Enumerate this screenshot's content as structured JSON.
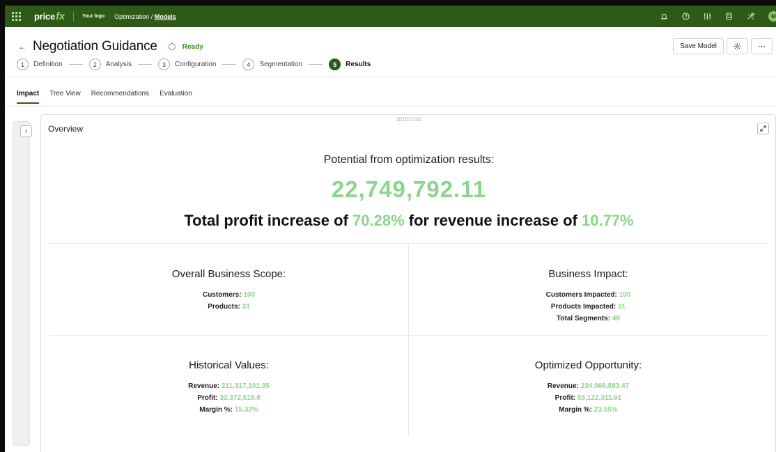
{
  "topbar": {
    "brand_main": "price",
    "brand_fx": "fx",
    "logo_text": "Your logo",
    "crumb_section": "Optimization /",
    "crumb_link": "Models",
    "avatar_initial": "M"
  },
  "header": {
    "title": "Negotiation Guidance",
    "status": "Ready",
    "save_label": "Save Model",
    "steps": [
      {
        "num": "1",
        "label": "Definition"
      },
      {
        "num": "2",
        "label": "Analysis"
      },
      {
        "num": "3",
        "label": "Configuration"
      },
      {
        "num": "4",
        "label": "Segmentation"
      },
      {
        "num": "5",
        "label": "Results"
      }
    ]
  },
  "tabs": [
    {
      "label": "Impact"
    },
    {
      "label": "Tree View"
    },
    {
      "label": "Recommendations"
    },
    {
      "label": "Evaluation"
    }
  ],
  "panel": {
    "title": "Overview",
    "potential_title": "Potential from optimization results:",
    "potential_value": "22,749,792.11",
    "profit_prefix": "Total profit increase of",
    "profit_pct": "70.28%",
    "revenue_prefix": "for revenue increase of",
    "revenue_pct": "10.77%"
  },
  "scope": {
    "title": "Overall Business Scope:",
    "customers_label": "Customers:",
    "customers": "100",
    "products_label": "Products:",
    "products": "31"
  },
  "impact": {
    "title": "Business Impact:",
    "customers_label": "Customers Impacted:",
    "customers": "100",
    "products_label": "Products Impacted:",
    "products": "31",
    "segments_label": "Total Segments:",
    "segments": "48"
  },
  "historical": {
    "title": "Historical Values:",
    "revenue_label": "Revenue:",
    "revenue": "211,317,101.35",
    "profit_label": "Profit:",
    "profit": "32,372,519.8",
    "margin_label": "Margin %:",
    "margin": "15.32%"
  },
  "optimized": {
    "title": "Optimized Opportunity:",
    "revenue_label": "Revenue:",
    "revenue": "234,066,893.47",
    "profit_label": "Profit:",
    "profit": "55,122,311.91",
    "margin_label": "Margin %:",
    "margin": "23.55%"
  },
  "colors": {
    "brand_green": "#2e5a17",
    "accent_green": "#8bd58c",
    "status_green": "#3d8a24"
  },
  "icons": [
    "apps-grid-icon",
    "bell-icon",
    "help-icon",
    "sliders-icon",
    "database-icon",
    "tools-icon",
    "back-arrow-icon",
    "gear-icon",
    "more-icon",
    "chevron-right-icon",
    "expand-icon"
  ]
}
